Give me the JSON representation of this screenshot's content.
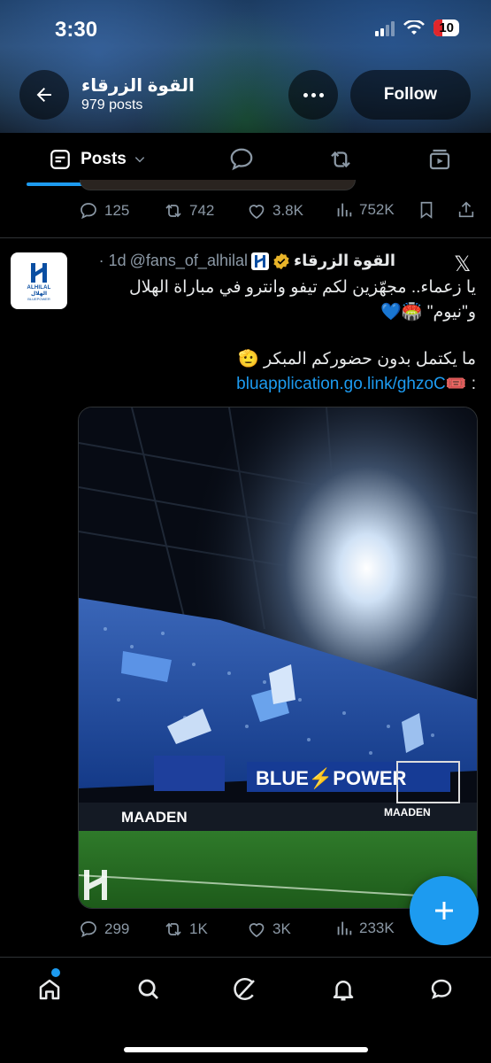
{
  "status_bar": {
    "time": "3:30",
    "battery": "10"
  },
  "header": {
    "profile_name": "القوة الزرقاء",
    "post_count": "979 posts",
    "follow_label": "Follow"
  },
  "tabs": [
    {
      "label": "Posts",
      "icon": "document-icon"
    },
    {
      "label": "",
      "icon": "reply-icon"
    },
    {
      "label": "",
      "icon": "repost-icon"
    },
    {
      "label": "",
      "icon": "media-icon"
    }
  ],
  "previous_post": {
    "replies": "125",
    "reposts": "742",
    "likes": "3.8K",
    "views": "752K"
  },
  "post": {
    "author_name": "القوة الزرقاء",
    "handle": "@fans_of_alhilal",
    "time": "· 1d",
    "text_line1": "يا زعماء.. مجهّزين لكم تيفو وانترو في مباراة الهلال",
    "text_line2": "و\"نيوم\" 🏟️💙",
    "text_line3": "ما يكتمل بدون حضوركم المبكر 🫡",
    "ticket_prefix": "🎟️ : ",
    "link": "bluapplication.go.link/ghzoC",
    "avatar_text1": "ALHILAL",
    "avatar_text2": "الهلال",
    "avatar_text3": "BLUEPOWER",
    "image_banner1": "BLUE⚡POWER",
    "image_banner2": "MAADEN",
    "image_banner3": "MAADEN",
    "replies": "299",
    "reposts": "1K",
    "likes": "3K",
    "views": "233K"
  },
  "colors": {
    "accent": "#1d9bf0",
    "muted": "#8b98a5",
    "text": "#e7e9ea",
    "divider": "#2f3336"
  },
  "bottom_nav": [
    "home-icon",
    "search-icon",
    "grok-icon",
    "notifications-icon",
    "messages-icon"
  ]
}
